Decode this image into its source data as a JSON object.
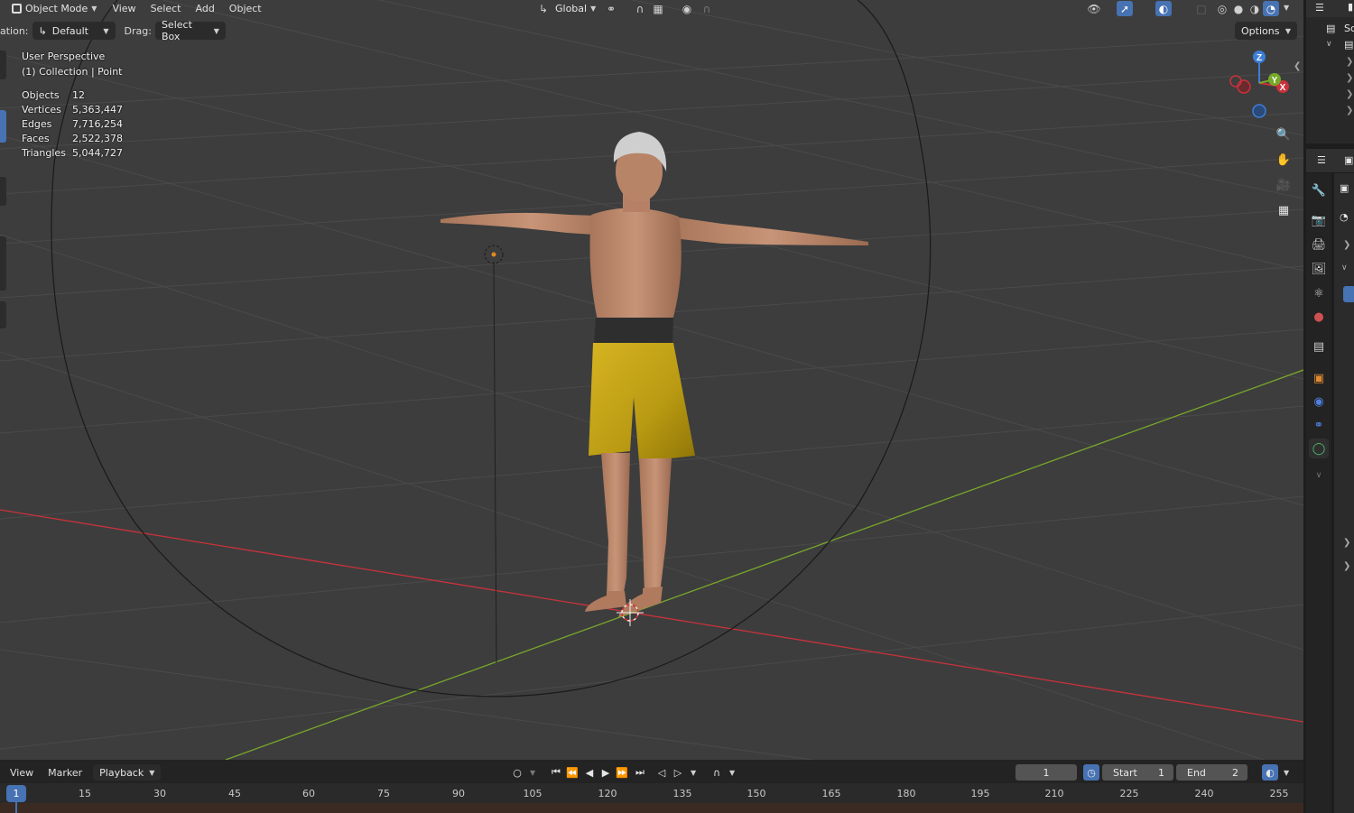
{
  "header": {
    "mode": "Object Mode",
    "menus": [
      "View",
      "Select",
      "Add",
      "Object"
    ],
    "orientation": "Global"
  },
  "toolbar": {
    "orientation_label": "ation:",
    "orientation_value": "Default",
    "drag_label": "Drag:",
    "drag_value": "Select Box",
    "options_label": "Options"
  },
  "overlay": {
    "perspective": "User Perspective",
    "collection": "(1) Collection | Point",
    "stats": [
      {
        "key": "Objects",
        "value": "12"
      },
      {
        "key": "Vertices",
        "value": "5,363,447"
      },
      {
        "key": "Edges",
        "value": "7,716,254"
      },
      {
        "key": "Faces",
        "value": "2,522,378"
      },
      {
        "key": "Triangles",
        "value": "5,044,727"
      }
    ]
  },
  "gizmo": {
    "z": "Z",
    "y": "Y",
    "x": "X"
  },
  "outliner": {
    "scene_label": "Sc"
  },
  "timeline": {
    "menus": [
      "View",
      "Marker"
    ],
    "playback": "Playback",
    "current_frame": "1",
    "start_label": "Start",
    "start_value": "1",
    "end_label": "End",
    "end_value": "2",
    "ruler": [
      "15",
      "30",
      "45",
      "60",
      "75",
      "90",
      "105",
      "120",
      "135",
      "150",
      "165",
      "180",
      "195",
      "210",
      "225",
      "240",
      "255"
    ],
    "playhead": "1"
  },
  "colors": {
    "accent": "#4772b3",
    "x_axis": "#c8323c",
    "y_axis": "#78a82a",
    "z_axis": "#3d7ed8",
    "shorts": "#c9a815"
  }
}
